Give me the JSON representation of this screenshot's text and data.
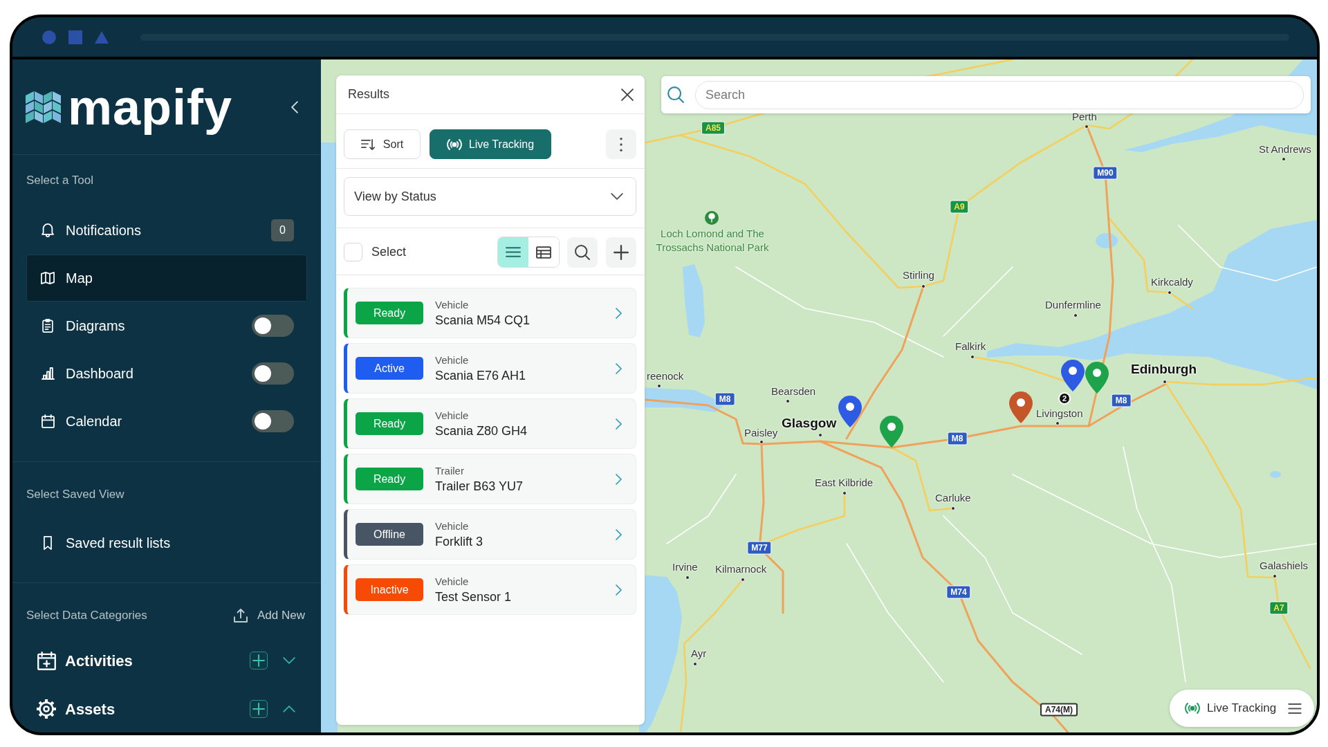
{
  "sidebar": {
    "logo": "mapify",
    "sections": [
      {
        "heading": "Select a Tool",
        "items": [
          {
            "label": "Notifications",
            "kind": "count",
            "count": "0",
            "selected": false
          },
          {
            "label": "Map",
            "kind": "plain",
            "selected": true
          },
          {
            "label": "Diagrams",
            "kind": "toggle",
            "on": false,
            "selected": false
          },
          {
            "label": "Dashboard",
            "kind": "toggle",
            "on": false,
            "selected": false
          },
          {
            "label": "Calendar",
            "kind": "toggle",
            "on": false,
            "selected": false
          }
        ]
      },
      {
        "heading": "Select Saved View",
        "items": [
          {
            "label": "Saved result lists",
            "kind": "plain",
            "selected": false
          }
        ]
      }
    ],
    "data_categories": {
      "heading": "Select Data Categories",
      "add_button": "Add New",
      "items": [
        {
          "label": "Activities",
          "expanded": false
        },
        {
          "label": "Assets",
          "expanded": true
        }
      ]
    }
  },
  "results_panel": {
    "title": "Results",
    "sort_button": "Sort",
    "live_tracking_button": {
      "label": "Live Tracking",
      "on": true
    },
    "view_select": {
      "value": "View by Status"
    },
    "select_all": {
      "label": "Select",
      "checked": false
    },
    "view_modes": [
      {
        "kind": "list",
        "selected": true
      },
      {
        "kind": "table",
        "selected": false
      }
    ],
    "results": [
      {
        "status": "Ready",
        "color": "#0ba548",
        "type": "Vehicle",
        "name": "Scania M54 CQ1"
      },
      {
        "status": "Active",
        "color": "#1f5cf0",
        "type": "Vehicle",
        "name": "Scania E76 AH1"
      },
      {
        "status": "Ready",
        "color": "#0ba548",
        "type": "Vehicle",
        "name": "Scania Z80 GH4"
      },
      {
        "status": "Ready",
        "color": "#0ba548",
        "type": "Trailer",
        "name": "Trailer B63 YU7"
      },
      {
        "status": "Offline",
        "color": "#475564",
        "type": "Vehicle",
        "name": "Forklift 3"
      },
      {
        "status": "Inactive",
        "color": "#f74b05",
        "type": "Vehicle",
        "name": "Test Sensor 1"
      }
    ]
  },
  "map": {
    "search": {
      "placeholder": "Search"
    },
    "park": {
      "name": "Loch Lomond and The Trossachs National Park"
    },
    "places": [
      {
        "name": "Perth",
        "kind": "town"
      },
      {
        "name": "St Andrews",
        "kind": "town"
      },
      {
        "name": "Stirling",
        "kind": "town"
      },
      {
        "name": "Kirkcaldy",
        "kind": "town"
      },
      {
        "name": "Dunfermline",
        "kind": "town"
      },
      {
        "name": "Falkirk",
        "kind": "town"
      },
      {
        "name": "Edinburgh",
        "kind": "city"
      },
      {
        "name": "reenock",
        "kind": "town"
      },
      {
        "name": "Bearsden",
        "kind": "town"
      },
      {
        "name": "Livingston",
        "kind": "town"
      },
      {
        "name": "Glasgow",
        "kind": "city"
      },
      {
        "name": "Paisley",
        "kind": "town"
      },
      {
        "name": "East Kilbride",
        "kind": "town"
      },
      {
        "name": "Carluke",
        "kind": "town"
      },
      {
        "name": "Irvine",
        "kind": "town"
      },
      {
        "name": "Kilmarnock",
        "kind": "town"
      },
      {
        "name": "Galashiels",
        "kind": "town"
      },
      {
        "name": "Ayr",
        "kind": "town"
      }
    ],
    "roads": [
      {
        "label": "A85",
        "kind": "primary"
      },
      {
        "label": "M90",
        "kind": "motorway"
      },
      {
        "label": "A9",
        "kind": "primary"
      },
      {
        "label": "M8",
        "kind": "motorway"
      },
      {
        "label": "M8",
        "kind": "motorway"
      },
      {
        "label": "M8",
        "kind": "motorway"
      },
      {
        "label": "M77",
        "kind": "motorway"
      },
      {
        "label": "M74",
        "kind": "motorway"
      },
      {
        "label": "A7",
        "kind": "primary"
      },
      {
        "label": "A74(M)",
        "kind": "plain"
      }
    ],
    "markers": [
      {
        "color": "#2d5be3"
      },
      {
        "color": "#1fa34a"
      },
      {
        "color": "#c4562a"
      },
      {
        "color": "#2d5be3"
      },
      {
        "color": "#1fa34a"
      }
    ],
    "cluster": {
      "count": "2"
    },
    "live_tracking": {
      "label": "Live Tracking"
    }
  }
}
